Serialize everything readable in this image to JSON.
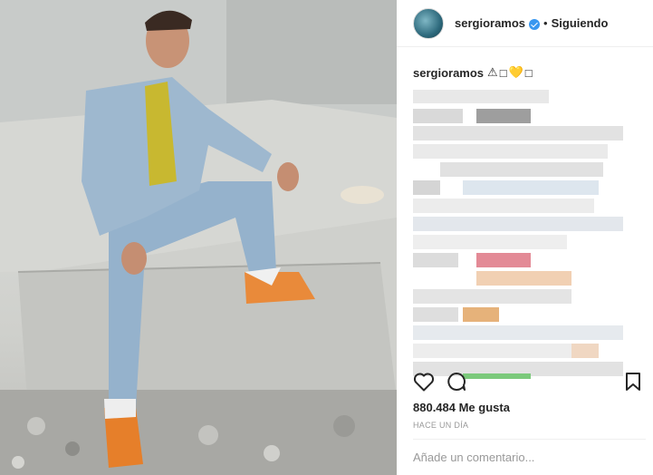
{
  "post": {
    "username": "sergioramos",
    "separator": "•",
    "follow_status": "Siguiendo",
    "caption_username": "sergioramos",
    "caption_emojis": [
      "⚠",
      "□",
      "💛",
      "□"
    ],
    "likes": "880.484 Me gusta",
    "time": "HACE UN DÍA",
    "comment_placeholder": "Añade un comentario..."
  },
  "icons": {
    "verified": "verified-badge-icon",
    "like": "heart-icon",
    "comment": "comment-bubble-icon",
    "save": "bookmark-icon"
  },
  "colors": {
    "verified": "#3897f0",
    "text": "#262626",
    "muted": "#999999"
  }
}
